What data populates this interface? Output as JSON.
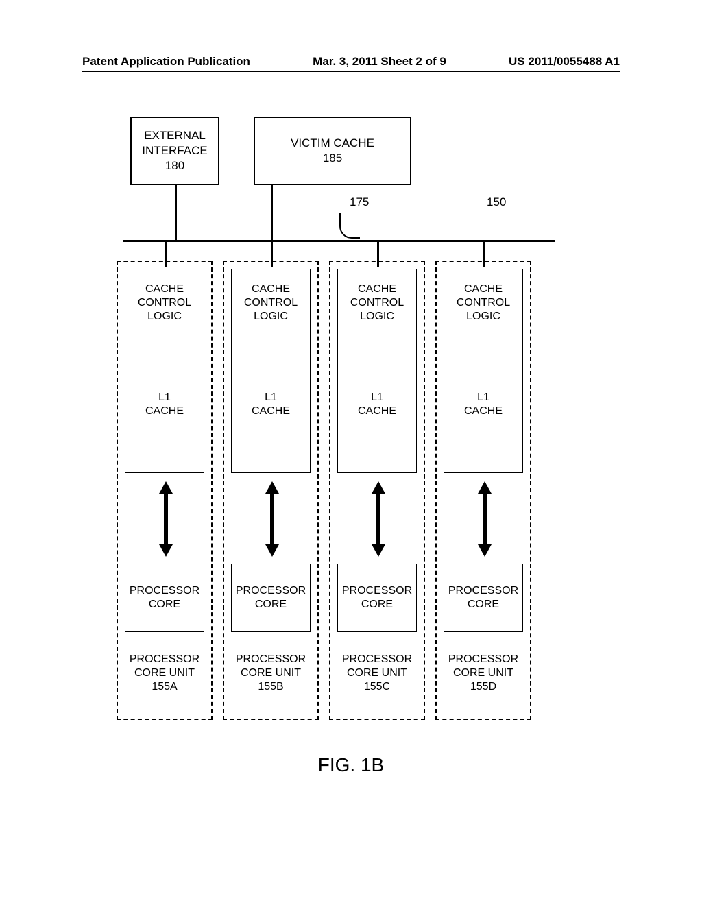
{
  "header": {
    "left": "Patent Application Publication",
    "center": "Mar. 3, 2011  Sheet 2 of 9",
    "right": "US 2011/0055488 A1"
  },
  "blocks": {
    "external_interface": "EXTERNAL\nINTERFACE\n180",
    "victim_cache": "VICTIM CACHE\n185",
    "bus_label_175": "175",
    "bus_label_150": "150",
    "cache_control": "CACHE\nCONTROL\nLOGIC",
    "l1_cache": "L1\nCACHE",
    "processor_core": "PROCESSOR\nCORE"
  },
  "core_units": [
    "PROCESSOR\nCORE UNIT\n155A",
    "PROCESSOR\nCORE UNIT\n155B",
    "PROCESSOR\nCORE UNIT\n155C",
    "PROCESSOR\nCORE UNIT\n155D"
  ],
  "figure_label": "FIG. 1B"
}
